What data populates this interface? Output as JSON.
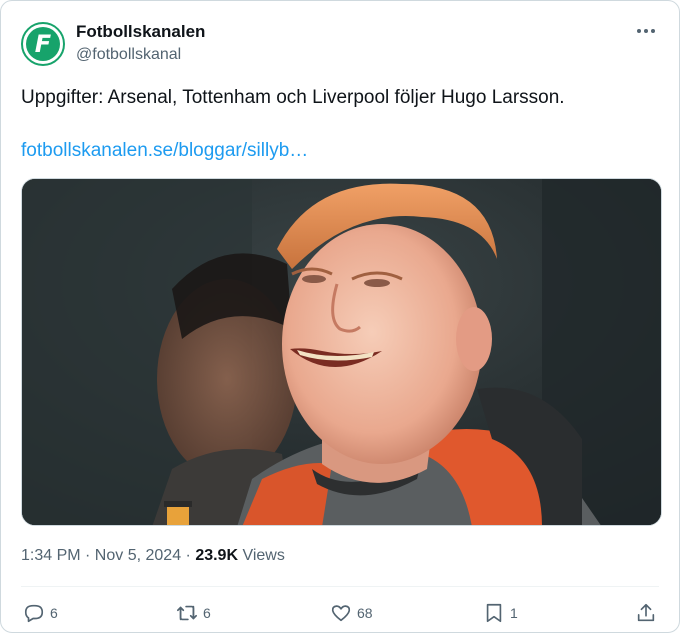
{
  "author": {
    "display_name": "Fotbollskanalen",
    "handle": "@fotbollskanal",
    "avatar_letter": "F",
    "brand_color": "#17a36b"
  },
  "tweet": {
    "text": "Uppgifter: Arsenal, Tottenham och Liverpool följer Hugo Larsson.",
    "link": "fotbollskanalen.se/bloggar/sillyb…",
    "link_color": "#1d9bf0"
  },
  "meta": {
    "timestamp": "1:34 PM · Nov 5, 2024 · ",
    "views_count": "23.9K",
    "views_label": " Views"
  },
  "actions": {
    "replies": "6",
    "reposts": "6",
    "likes": "68",
    "bookmarks": "1"
  },
  "icons": {
    "more": "more-icon",
    "reply": "reply-icon",
    "repost": "repost-icon",
    "like": "heart-icon",
    "bookmark": "bookmark-icon",
    "share": "share-icon"
  }
}
